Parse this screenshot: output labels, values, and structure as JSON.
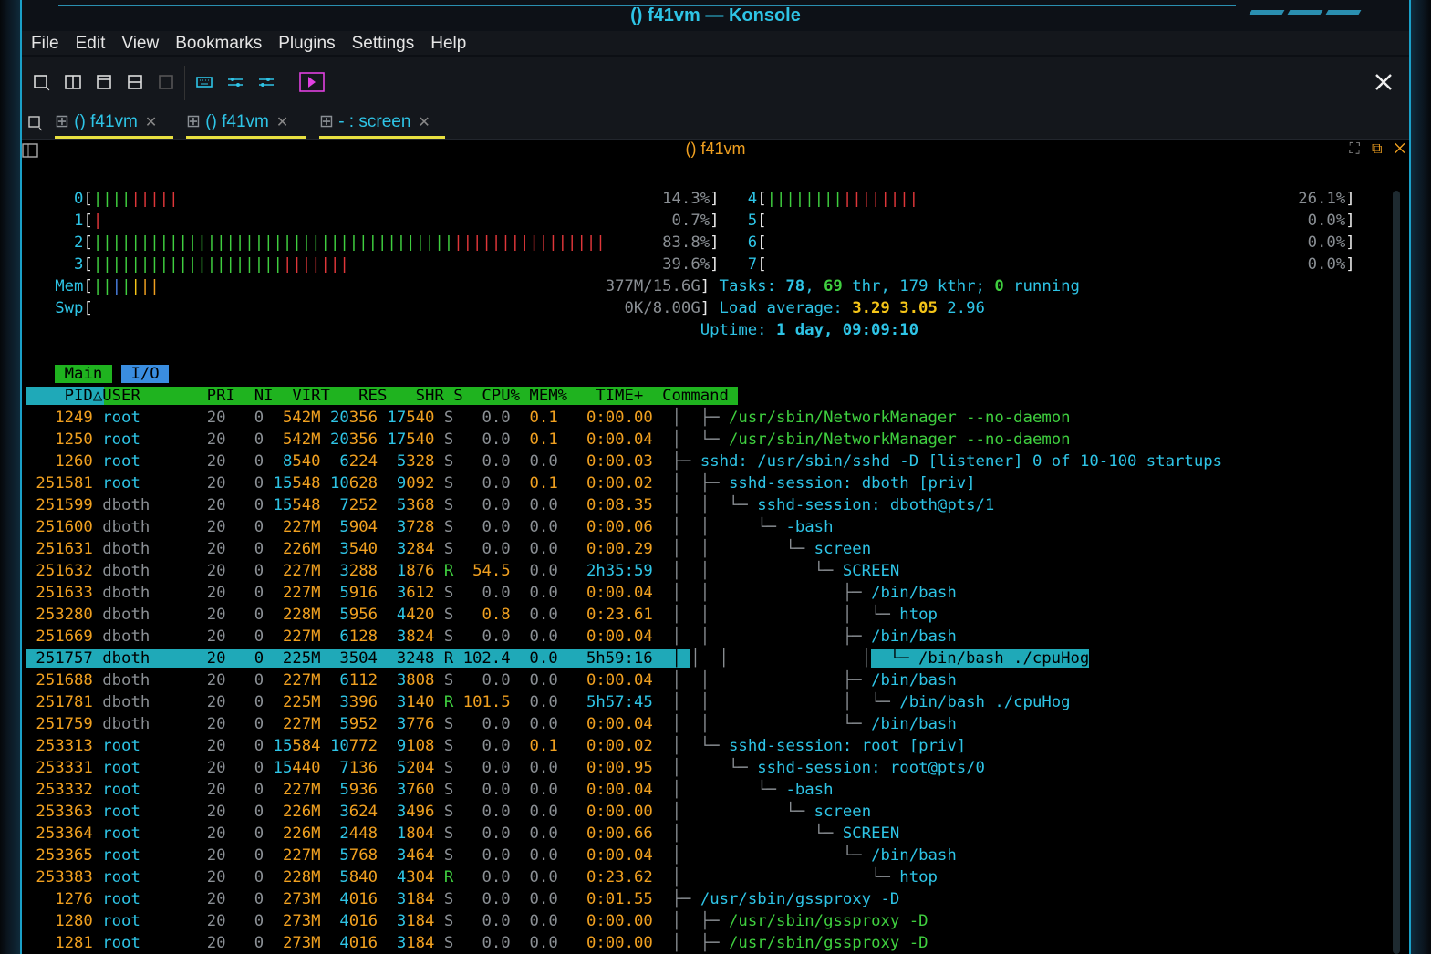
{
  "window": {
    "title": "() f41vm — Konsole"
  },
  "menu": [
    "File",
    "Edit",
    "View",
    "Bookmarks",
    "Plugins",
    "Settings",
    "Help"
  ],
  "tabs": [
    {
      "label": "() f41vm"
    },
    {
      "label": "() f41vm"
    },
    {
      "label": "- : screen"
    }
  ],
  "terminal": {
    "title": "() f41vm"
  },
  "cpu_left": [
    {
      "id": "0",
      "green": "||||",
      "red": "|||||",
      "pct": "14.3%]"
    },
    {
      "id": "1",
      "green": "",
      "red": "|",
      "pct": "0.7%]"
    },
    {
      "id": "2",
      "green": "||||||||||||||||||||||||||||||||||||||",
      "red": "||||||||||||||||",
      "pct": "83.8%]"
    },
    {
      "id": "3",
      "green": "||||||||||||||||||||",
      "red": "|||||||",
      "pct": "39.6%]"
    }
  ],
  "cpu_right": [
    {
      "id": "4",
      "green": "||||||||",
      "red": "||||||||",
      "pct": "26.1%]"
    },
    {
      "id": "5",
      "green": "",
      "red": "",
      "pct": "0.0%]"
    },
    {
      "id": "6",
      "green": "",
      "red": "",
      "pct": "0.0%]"
    },
    {
      "id": "7",
      "green": "",
      "red": "",
      "pct": "0.0%]"
    }
  ],
  "mem": {
    "label": "Mem",
    "value": "377M/15.6G]"
  },
  "swp": {
    "label": "Swp",
    "value": "0K/8.00G]"
  },
  "tasks": {
    "label": "Tasks:",
    "a": "78",
    "b": "69",
    "thr": "thr,",
    "kthr": "179 kthr;",
    "run": "0",
    "running": "running"
  },
  "load": {
    "label": "Load average:",
    "v1": "3.29",
    "v2": "3.05",
    "v3": "2.96"
  },
  "uptime": {
    "label": "Uptime:",
    "value": "1 day, 09:09:10"
  },
  "tabs_htop": {
    "main": "Main",
    "io": "I/O"
  },
  "columns": "    PID△USER       PRI  NI  VIRT   RES   SHR S  CPU% MEM%   TIME+  Command",
  "rows": [
    {
      "pid": "1249",
      "user": "root",
      "pri": "20",
      "ni": "0",
      "virt": "542M",
      "res": "20356",
      "shr": "17540",
      "s": "S",
      "cpu": "0.0",
      "mem": "0.1",
      "time": "0:00.00",
      "tree": "│  ├─ ",
      "cmd": "/usr/sbin/NetworkManager --no-daemon",
      "thread": true
    },
    {
      "pid": "1250",
      "user": "root",
      "pri": "20",
      "ni": "0",
      "virt": "542M",
      "res": "20356",
      "shr": "17540",
      "s": "S",
      "cpu": "0.0",
      "mem": "0.1",
      "time": "0:00.04",
      "tree": "│  └─ ",
      "cmd": "/usr/sbin/NetworkManager --no-daemon",
      "thread": true
    },
    {
      "pid": "1260",
      "user": "root",
      "pri": "20",
      "ni": "0",
      "virt": "8540",
      "res": "6224",
      "shr": "5328",
      "s": "S",
      "cpu": "0.0",
      "mem": "0.0",
      "time": "0:00.03",
      "tree": "├─ ",
      "cmd": "sshd: /usr/sbin/sshd -D [listener] 0 of 10-100 startups"
    },
    {
      "pid": "251581",
      "user": "root",
      "pri": "20",
      "ni": "0",
      "virt": "15548",
      "res": "10628",
      "shr": "9092",
      "s": "S",
      "cpu": "0.0",
      "mem": "0.1",
      "time": "0:00.02",
      "tree": "│  ├─ ",
      "cmd": "sshd-session: dboth [priv]"
    },
    {
      "pid": "251599",
      "user": "dboth",
      "pri": "20",
      "ni": "0",
      "virt": "15548",
      "res": "7252",
      "shr": "5368",
      "s": "S",
      "cpu": "0.0",
      "mem": "0.0",
      "time": "0:08.35",
      "tree": "│  │  └─ ",
      "cmd": "sshd-session: dboth@pts/1"
    },
    {
      "pid": "251600",
      "user": "dboth",
      "pri": "20",
      "ni": "0",
      "virt": "227M",
      "res": "5904",
      "shr": "3728",
      "s": "S",
      "cpu": "0.0",
      "mem": "0.0",
      "time": "0:00.06",
      "tree": "│  │     └─ ",
      "cmd": "-bash"
    },
    {
      "pid": "251631",
      "user": "dboth",
      "pri": "20",
      "ni": "0",
      "virt": "226M",
      "res": "3540",
      "shr": "3284",
      "s": "S",
      "cpu": "0.0",
      "mem": "0.0",
      "time": "0:00.29",
      "tree": "│  │        └─ ",
      "cmd": "screen"
    },
    {
      "pid": "251632",
      "user": "dboth",
      "pri": "20",
      "ni": "0",
      "virt": "227M",
      "res": "3288",
      "shr": "1876",
      "s": "R",
      "cpu": "54.5",
      "mem": "0.0",
      "time": "2h35:59",
      "tree": "│  │           └─ ",
      "cmd": "SCREEN"
    },
    {
      "pid": "251633",
      "user": "dboth",
      "pri": "20",
      "ni": "0",
      "virt": "227M",
      "res": "5916",
      "shr": "3612",
      "s": "S",
      "cpu": "0.0",
      "mem": "0.0",
      "time": "0:00.04",
      "tree": "│  │              ├─ ",
      "cmd": "/bin/bash"
    },
    {
      "pid": "253280",
      "user": "dboth",
      "pri": "20",
      "ni": "0",
      "virt": "228M",
      "res": "5956",
      "shr": "4420",
      "s": "S",
      "cpu": "0.8",
      "mem": "0.0",
      "time": "0:23.61",
      "tree": "│  │              │  └─ ",
      "cmd": "htop"
    },
    {
      "pid": "251669",
      "user": "dboth",
      "pri": "20",
      "ni": "0",
      "virt": "227M",
      "res": "6128",
      "shr": "3824",
      "s": "S",
      "cpu": "0.0",
      "mem": "0.0",
      "time": "0:00.04",
      "tree": "│  │              ├─ ",
      "cmd": "/bin/bash"
    },
    {
      "pid": "251757",
      "user": "dboth",
      "pri": "20",
      "ni": "0",
      "virt": "225M",
      "res": "3504",
      "shr": "3248",
      "s": "R",
      "cpu": "102.4",
      "mem": "0.0",
      "time": "5h59:16",
      "tree": "│  │              │  └─ ",
      "cmd": "/bin/bash ./cpuHog",
      "selected": true
    },
    {
      "pid": "251688",
      "user": "dboth",
      "pri": "20",
      "ni": "0",
      "virt": "227M",
      "res": "6112",
      "shr": "3808",
      "s": "S",
      "cpu": "0.0",
      "mem": "0.0",
      "time": "0:00.04",
      "tree": "│  │              ├─ ",
      "cmd": "/bin/bash"
    },
    {
      "pid": "251781",
      "user": "dboth",
      "pri": "20",
      "ni": "0",
      "virt": "225M",
      "res": "3396",
      "shr": "3140",
      "s": "R",
      "cpu": "101.5",
      "mem": "0.0",
      "time": "5h57:45",
      "tree": "│  │              │  └─ ",
      "cmd": "/bin/bash ./cpuHog"
    },
    {
      "pid": "251759",
      "user": "dboth",
      "pri": "20",
      "ni": "0",
      "virt": "227M",
      "res": "5952",
      "shr": "3776",
      "s": "S",
      "cpu": "0.0",
      "mem": "0.0",
      "time": "0:00.04",
      "tree": "│  │              └─ ",
      "cmd": "/bin/bash"
    },
    {
      "pid": "253313",
      "user": "root",
      "pri": "20",
      "ni": "0",
      "virt": "15584",
      "res": "10772",
      "shr": "9108",
      "s": "S",
      "cpu": "0.0",
      "mem": "0.1",
      "time": "0:00.02",
      "tree": "│  └─ ",
      "cmd": "sshd-session: root [priv]"
    },
    {
      "pid": "253331",
      "user": "root",
      "pri": "20",
      "ni": "0",
      "virt": "15440",
      "res": "7136",
      "shr": "5204",
      "s": "S",
      "cpu": "0.0",
      "mem": "0.0",
      "time": "0:00.95",
      "tree": "│     └─ ",
      "cmd": "sshd-session: root@pts/0"
    },
    {
      "pid": "253332",
      "user": "root",
      "pri": "20",
      "ni": "0",
      "virt": "227M",
      "res": "5936",
      "shr": "3760",
      "s": "S",
      "cpu": "0.0",
      "mem": "0.0",
      "time": "0:00.04",
      "tree": "│        └─ ",
      "cmd": "-bash"
    },
    {
      "pid": "253363",
      "user": "root",
      "pri": "20",
      "ni": "0",
      "virt": "226M",
      "res": "3624",
      "shr": "3496",
      "s": "S",
      "cpu": "0.0",
      "mem": "0.0",
      "time": "0:00.00",
      "tree": "│           └─ ",
      "cmd": "screen"
    },
    {
      "pid": "253364",
      "user": "root",
      "pri": "20",
      "ni": "0",
      "virt": "226M",
      "res": "2448",
      "shr": "1804",
      "s": "S",
      "cpu": "0.0",
      "mem": "0.0",
      "time": "0:00.66",
      "tree": "│              └─ ",
      "cmd": "SCREEN"
    },
    {
      "pid": "253365",
      "user": "root",
      "pri": "20",
      "ni": "0",
      "virt": "227M",
      "res": "5768",
      "shr": "3464",
      "s": "S",
      "cpu": "0.0",
      "mem": "0.0",
      "time": "0:00.04",
      "tree": "│                 └─ ",
      "cmd": "/bin/bash"
    },
    {
      "pid": "253383",
      "user": "root",
      "pri": "20",
      "ni": "0",
      "virt": "228M",
      "res": "5840",
      "shr": "4304",
      "s": "R",
      "cpu": "0.0",
      "mem": "0.0",
      "time": "0:23.62",
      "tree": "│                    └─ ",
      "cmd": "htop"
    },
    {
      "pid": "1276",
      "user": "root",
      "pri": "20",
      "ni": "0",
      "virt": "273M",
      "res": "4016",
      "shr": "3184",
      "s": "S",
      "cpu": "0.0",
      "mem": "0.0",
      "time": "0:01.55",
      "tree": "├─ ",
      "cmd": "/usr/sbin/gssproxy -D"
    },
    {
      "pid": "1280",
      "user": "root",
      "pri": "20",
      "ni": "0",
      "virt": "273M",
      "res": "4016",
      "shr": "3184",
      "s": "S",
      "cpu": "0.0",
      "mem": "0.0",
      "time": "0:00.00",
      "tree": "│  ├─ ",
      "cmd": "/usr/sbin/gssproxy -D",
      "thread": true
    },
    {
      "pid": "1281",
      "user": "root",
      "pri": "20",
      "ni": "0",
      "virt": "273M",
      "res": "4016",
      "shr": "3184",
      "s": "S",
      "cpu": "0.0",
      "mem": "0.0",
      "time": "0:00.00",
      "tree": "│  ├─ ",
      "cmd": "/usr/sbin/gssproxy -D",
      "thread": true
    }
  ]
}
